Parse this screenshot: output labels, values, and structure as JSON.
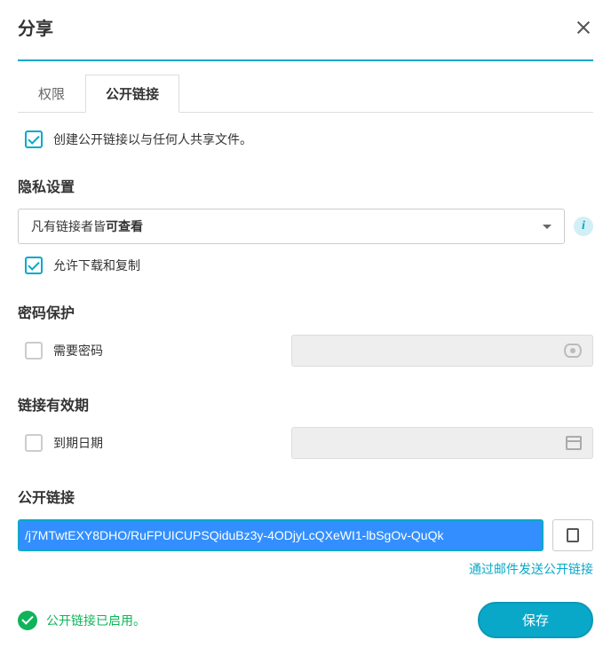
{
  "header": {
    "title": "分享"
  },
  "tabs": {
    "permissions": "权限",
    "public_link": "公开链接"
  },
  "create_link": {
    "label": "创建公开链接以与任何人共享文件。"
  },
  "privacy": {
    "title": "隐私设置",
    "select_prefix": "凡有链接者皆",
    "select_bold": "可查看",
    "info": "i",
    "allow_download": "允许下载和复制"
  },
  "password": {
    "title": "密码保护",
    "require": "需要密码"
  },
  "expiry": {
    "title": "链接有效期",
    "expire_date": "到期日期"
  },
  "public_link": {
    "title": "公开链接",
    "url": "/j7MTwtEXY8DHO/RuFPUICUPSQiduBz3y-4ODjyLcQXeWI1-lbSgOv-QuQk",
    "email_label": "通过邮件发送公开链接"
  },
  "footer": {
    "status": "公开链接已启用。",
    "save": "保存"
  }
}
